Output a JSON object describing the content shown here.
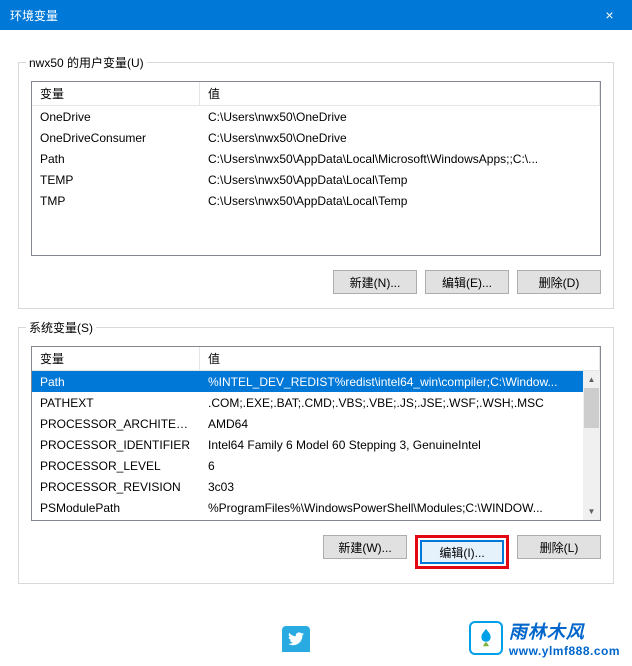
{
  "window": {
    "title": "环境变量",
    "close_icon": "×"
  },
  "user_vars": {
    "label": "nwx50 的用户变量(U)",
    "header_var": "变量",
    "header_val": "值",
    "rows": [
      {
        "var": "OneDrive",
        "val": "C:\\Users\\nwx50\\OneDrive"
      },
      {
        "var": "OneDriveConsumer",
        "val": "C:\\Users\\nwx50\\OneDrive"
      },
      {
        "var": "Path",
        "val": "C:\\Users\\nwx50\\AppData\\Local\\Microsoft\\WindowsApps;;C:\\..."
      },
      {
        "var": "TEMP",
        "val": "C:\\Users\\nwx50\\AppData\\Local\\Temp"
      },
      {
        "var": "TMP",
        "val": "C:\\Users\\nwx50\\AppData\\Local\\Temp"
      }
    ],
    "btn_new": "新建(N)...",
    "btn_edit": "编辑(E)...",
    "btn_delete": "删除(D)"
  },
  "system_vars": {
    "label": "系统变量(S)",
    "header_var": "变量",
    "header_val": "值",
    "rows": [
      {
        "var": "Path",
        "val": "%INTEL_DEV_REDIST%redist\\intel64_win\\compiler;C:\\Window..."
      },
      {
        "var": "PATHEXT",
        "val": ".COM;.EXE;.BAT;.CMD;.VBS;.VBE;.JS;.JSE;.WSF;.WSH;.MSC"
      },
      {
        "var": "PROCESSOR_ARCHITECT...",
        "val": "AMD64"
      },
      {
        "var": "PROCESSOR_IDENTIFIER",
        "val": "Intel64 Family 6 Model 60 Stepping 3, GenuineIntel"
      },
      {
        "var": "PROCESSOR_LEVEL",
        "val": "6"
      },
      {
        "var": "PROCESSOR_REVISION",
        "val": "3c03"
      },
      {
        "var": "PSModulePath",
        "val": "%ProgramFiles%\\WindowsPowerShell\\Modules;C:\\WINDOW..."
      }
    ],
    "btn_new": "新建(W)...",
    "btn_edit": "编辑(I)...",
    "btn_delete": "删除(L)"
  },
  "watermark": {
    "cn": "雨林木风",
    "url": "www.ylmf888.com"
  }
}
